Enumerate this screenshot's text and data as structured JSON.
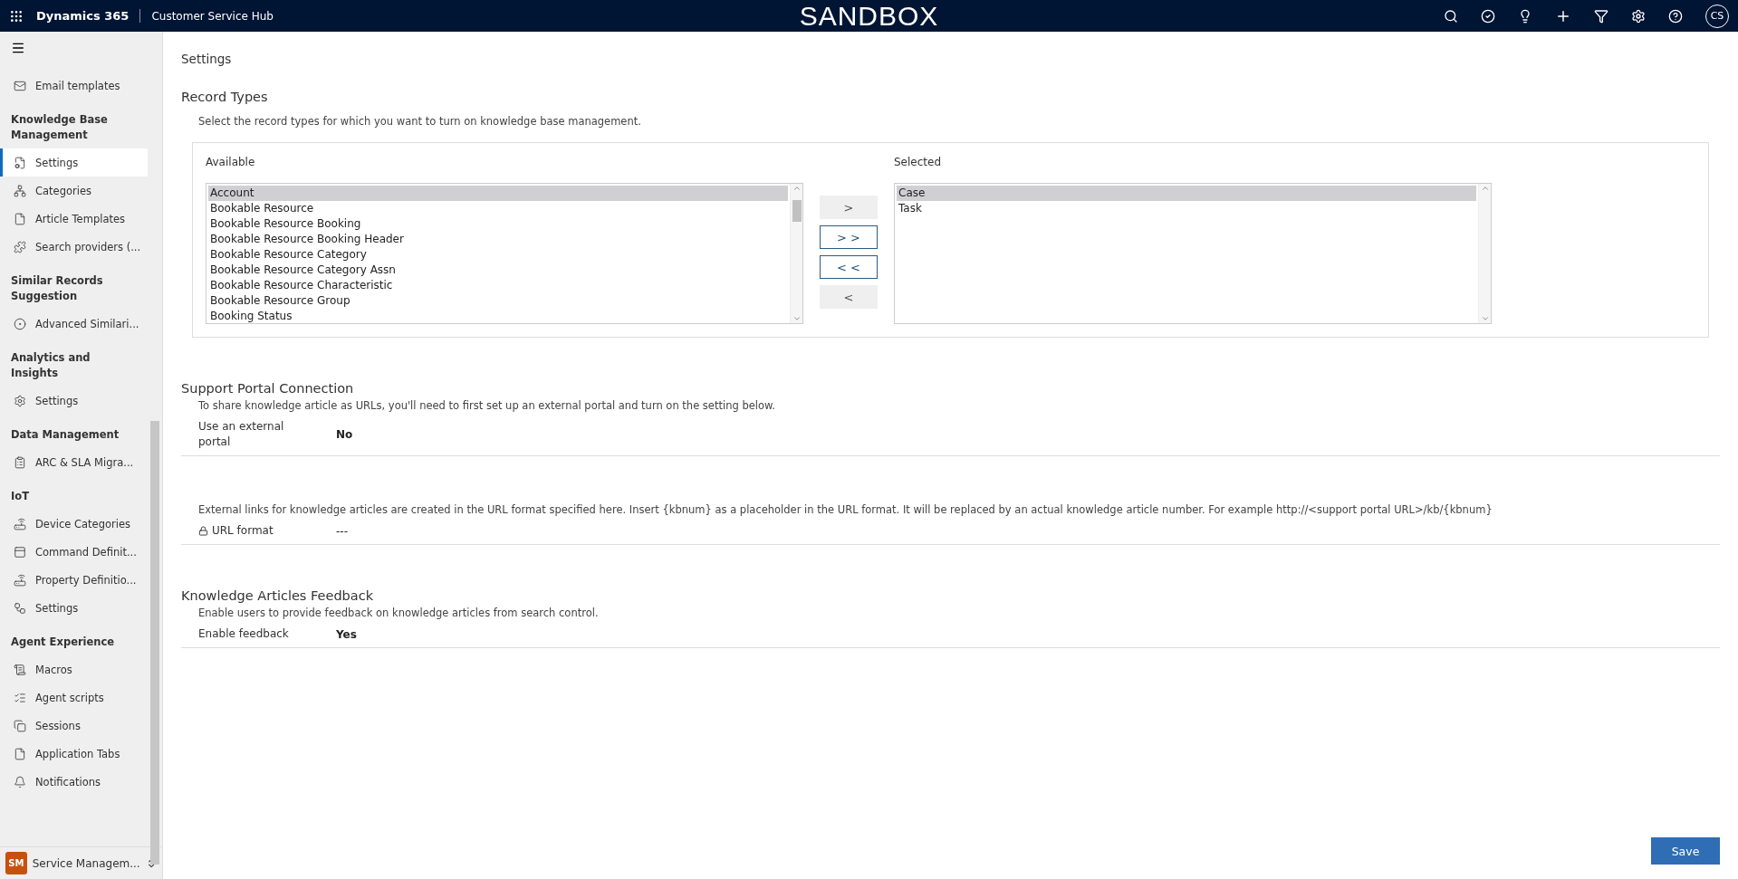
{
  "top_bar": {
    "brand": "Dynamics 365",
    "app": "Customer Service Hub",
    "environment": "SANDBOX",
    "user_initials": "CS"
  },
  "sidebar": {
    "groups": [
      {
        "items": [
          {
            "label": "Email templates",
            "selected": false
          }
        ]
      },
      {
        "title": "Knowledge Base Management",
        "items": [
          {
            "label": "Settings",
            "selected": true
          },
          {
            "label": "Categories",
            "selected": false
          },
          {
            "label": "Article Templates",
            "selected": false
          },
          {
            "label": "Search providers (...",
            "selected": false
          }
        ]
      },
      {
        "title": "Similar Records Suggestion",
        "items": [
          {
            "label": "Advanced Similari...",
            "selected": false
          }
        ]
      },
      {
        "title": "Analytics and Insights",
        "items": [
          {
            "label": "Settings",
            "selected": false
          }
        ]
      },
      {
        "title": "Data Management",
        "items": [
          {
            "label": "ARC & SLA Migra...",
            "selected": false
          }
        ]
      },
      {
        "title": "IoT",
        "items": [
          {
            "label": "Device Categories",
            "selected": false
          },
          {
            "label": "Command Definit...",
            "selected": false
          },
          {
            "label": "Property Definitio...",
            "selected": false
          },
          {
            "label": "Settings",
            "selected": false
          }
        ]
      },
      {
        "title": "Agent Experience",
        "items": [
          {
            "label": "Macros",
            "selected": false
          },
          {
            "label": "Agent scripts",
            "selected": false
          },
          {
            "label": "Sessions",
            "selected": false
          },
          {
            "label": "Application Tabs",
            "selected": false
          },
          {
            "label": "Notifications",
            "selected": false
          }
        ]
      }
    ],
    "area": {
      "initials": "SM",
      "label": "Service Managem..."
    }
  },
  "page_title": "Settings",
  "record_types": {
    "title": "Record Types",
    "description": "Select the record types for which you want to turn on knowledge base management.",
    "available": {
      "label": "Available",
      "items": [
        {
          "label": "Account",
          "selected": true
        },
        {
          "label": "Bookable Resource",
          "selected": false
        },
        {
          "label": "Bookable Resource Booking",
          "selected": false
        },
        {
          "label": "Bookable Resource Booking Header",
          "selected": false
        },
        {
          "label": "Bookable Resource Category",
          "selected": false
        },
        {
          "label": "Bookable Resource Category Assn",
          "selected": false
        },
        {
          "label": "Bookable Resource Characteristic",
          "selected": false
        },
        {
          "label": "Bookable Resource Group",
          "selected": false
        },
        {
          "label": "Booking Status",
          "selected": false
        }
      ]
    },
    "buttons": [
      {
        "label": ">",
        "disabled": true
      },
      {
        "label": "> >",
        "disabled": false
      },
      {
        "label": "< <",
        "disabled": false
      },
      {
        "label": "<",
        "disabled": true
      }
    ],
    "selected": {
      "label": "Selected",
      "items": [
        {
          "label": "Case",
          "selected": true
        },
        {
          "label": "Task",
          "selected": false
        }
      ]
    }
  },
  "sections": [
    {
      "title": "Support Portal Connection",
      "description": "To share knowledge article as URLs, you'll need to first set up an external portal and turn on the setting below.",
      "field": {
        "label": "Use an external portal",
        "value": "No",
        "locked": false
      }
    },
    {
      "description": "External links for knowledge articles are created in the URL format specified here. Insert {kbnum} as a placeholder in the URL format. It will be replaced by an actual knowledge article number. For example http://<support portal URL>/kb/{kbnum}",
      "field": {
        "label": "URL format",
        "value": "---",
        "locked": true
      }
    },
    {
      "title": "Knowledge Articles Feedback",
      "description": "Enable users to provide feedback on knowledge articles from search control.",
      "field": {
        "label": "Enable feedback",
        "value": "Yes",
        "locked": false
      }
    }
  ],
  "save_button": "Save"
}
